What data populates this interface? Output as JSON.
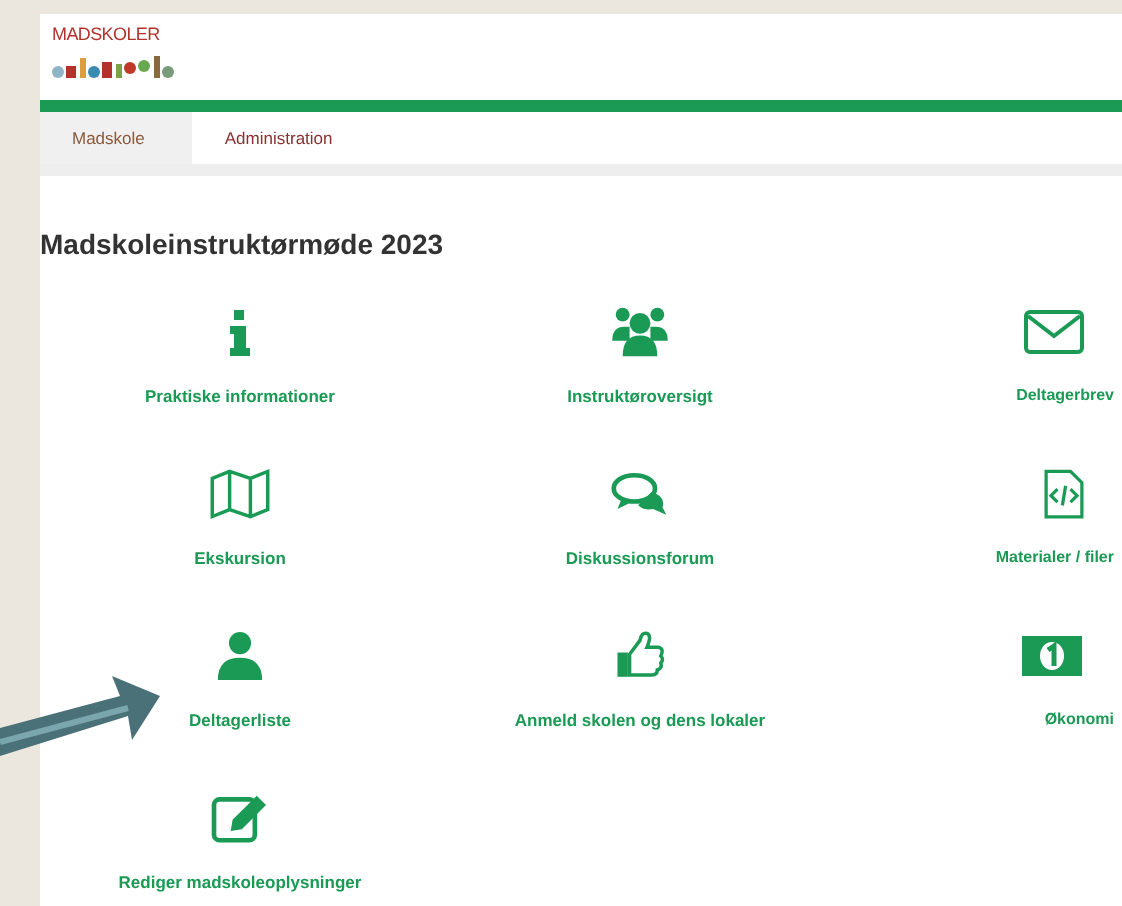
{
  "logo": {
    "text": "MADSKOLER"
  },
  "tabs": [
    {
      "label": "Madskole",
      "selected": true
    },
    {
      "label": "Administration",
      "selected": false
    }
  ],
  "heading": "Madskoleinstruktørmøde 2023",
  "tiles": [
    {
      "label": "Praktiske informationer"
    },
    {
      "label": "Instruktøroversigt"
    },
    {
      "label": "Deltagerbrev"
    },
    {
      "label": "Ekskursion"
    },
    {
      "label": "Diskussionsforum"
    },
    {
      "label": "Materialer / filer"
    },
    {
      "label": "Deltagerliste"
    },
    {
      "label": "Anmeld skolen og dens lokaler"
    },
    {
      "label": "Økonomi"
    },
    {
      "label": "Rediger madskoleoplysninger"
    }
  ]
}
